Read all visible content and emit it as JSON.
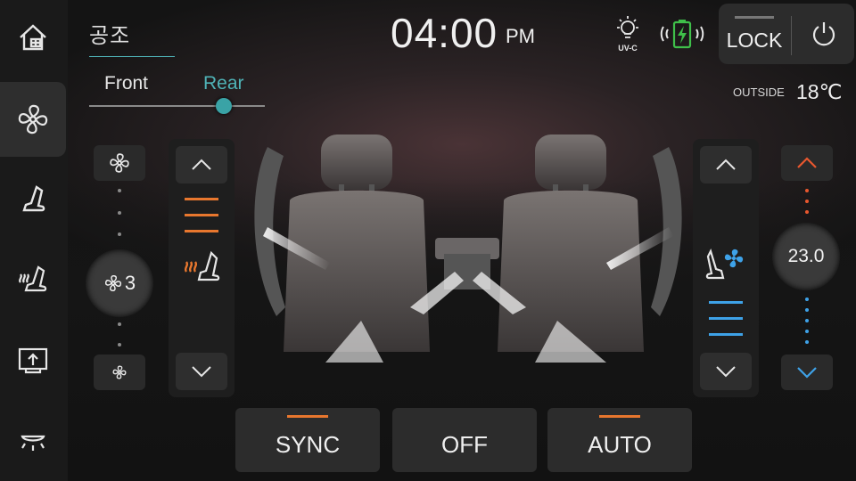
{
  "colors": {
    "accent_teal": "#4fb3b7",
    "heat_orange": "#e8772e",
    "cool_blue": "#3ea2e8",
    "battery_green": "#3fbf4a"
  },
  "sidebar": {
    "items": [
      {
        "name": "home",
        "icon": "home-icon",
        "active": false
      },
      {
        "name": "climate",
        "icon": "fan-icon",
        "active": true
      },
      {
        "name": "seat",
        "icon": "seat-icon",
        "active": false
      },
      {
        "name": "seat-heating",
        "icon": "seat-heat-icon",
        "active": false
      },
      {
        "name": "display",
        "icon": "screen-upload-icon",
        "active": false
      },
      {
        "name": "light",
        "icon": "dome-light-icon",
        "active": false
      }
    ]
  },
  "header": {
    "title": "공조",
    "tabs": [
      {
        "label": "Front"
      },
      {
        "label": "Rear"
      }
    ],
    "selected_tab": "Rear",
    "time": "04:00",
    "ampm": "PM",
    "uvc_label": "UV-C",
    "lock_label": "LOCK",
    "outside_label": "OUTSIDE",
    "outside_temp": "18℃"
  },
  "fan": {
    "level": "3"
  },
  "left_seat": {
    "heat_level": 3,
    "mode": "heating"
  },
  "right_seat": {
    "vent_level": 3,
    "mode": "ventilation"
  },
  "temperature": {
    "value": "23.0"
  },
  "bottom": {
    "sync": {
      "label": "SYNC",
      "active": true
    },
    "off": {
      "label": "OFF",
      "active": false
    },
    "auto": {
      "label": "AUTO",
      "active": true
    }
  }
}
